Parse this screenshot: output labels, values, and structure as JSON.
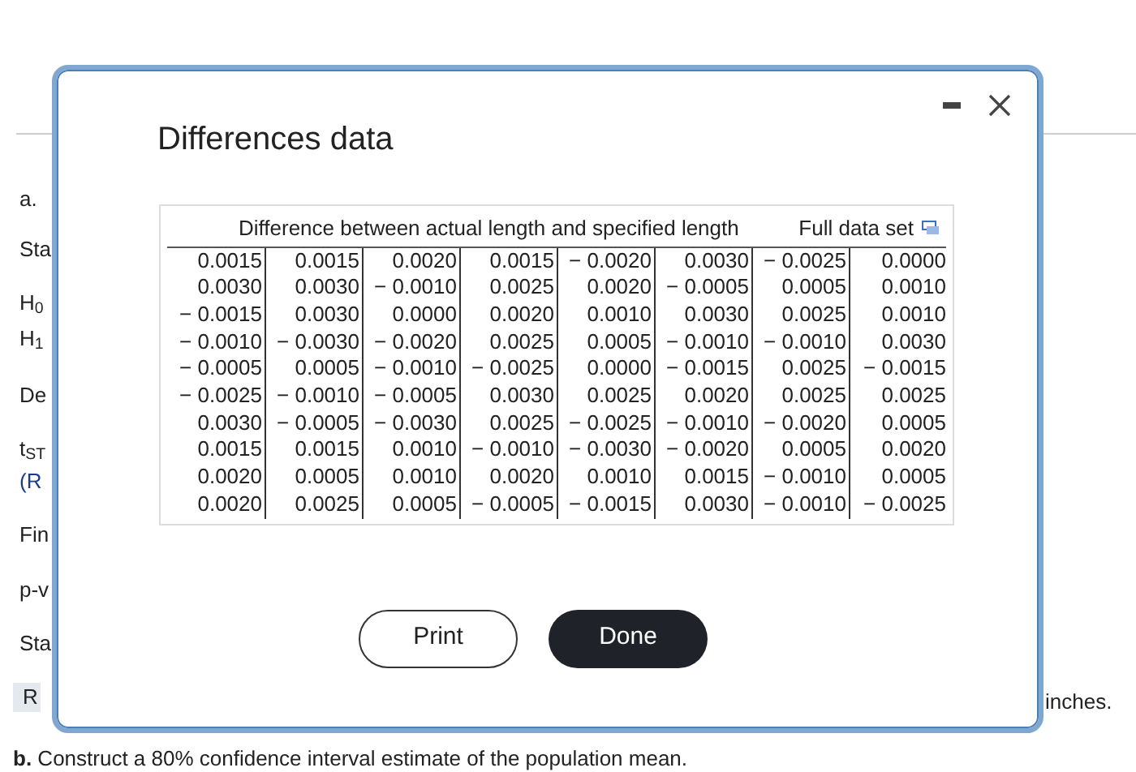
{
  "background": {
    "left_labels": [
      {
        "text": "a."
      },
      {
        "text": "Sta"
      },
      {
        "text": "H$_{0}$"
      },
      {
        "text": "H$_{1}$"
      },
      {
        "text": "De"
      },
      {
        "text": "t$_{ST}$"
      },
      {
        "text": "(R",
        "kind": "link"
      },
      {
        "text": "Fin"
      },
      {
        "text": "p-v"
      },
      {
        "text": "Sta"
      },
      {
        "text": "R",
        "kind": "highlight"
      }
    ],
    "right_text": "inches.",
    "question": "**b.** Construct a 80% confidence interval estimate of the population mean."
  },
  "dialog": {
    "title": "Differences data",
    "caption": "Difference between actual length and specified length",
    "full_data_link": "Full data set",
    "rows": [
      [
        "0.0015",
        "0.0015",
        "0.0020",
        "0.0015",
        "− 0.0020",
        "0.0030",
        "− 0.0025",
        "0.0000"
      ],
      [
        "0.0030",
        "0.0030",
        "− 0.0010",
        "0.0025",
        "0.0020",
        "− 0.0005",
        "0.0005",
        "0.0010"
      ],
      [
        "− 0.0015",
        "0.0030",
        "0.0000",
        "0.0020",
        "0.0010",
        "0.0030",
        "0.0025",
        "0.0010"
      ],
      [
        "− 0.0010",
        "− 0.0030",
        "− 0.0020",
        "0.0025",
        "0.0005",
        "− 0.0010",
        "− 0.0010",
        "0.0030"
      ],
      [
        "− 0.0005",
        "0.0005",
        "− 0.0010",
        "− 0.0025",
        "0.0000",
        "− 0.0015",
        "0.0025",
        "− 0.0015"
      ],
      [
        "− 0.0025",
        "− 0.0010",
        "− 0.0005",
        "0.0030",
        "0.0025",
        "0.0020",
        "0.0025",
        "0.0025"
      ],
      [
        "0.0030",
        "− 0.0005",
        "− 0.0030",
        "0.0025",
        "− 0.0025",
        "− 0.0010",
        "− 0.0020",
        "0.0005"
      ],
      [
        "0.0015",
        "0.0015",
        "0.0010",
        "− 0.0010",
        "− 0.0030",
        "− 0.0020",
        "0.0005",
        "0.0020"
      ],
      [
        "0.0020",
        "0.0005",
        "0.0010",
        "0.0020",
        "0.0010",
        "0.0015",
        "− 0.0010",
        "0.0005"
      ],
      [
        "0.0020",
        "0.0025",
        "0.0005",
        "− 0.0005",
        "− 0.0015",
        "0.0030",
        "− 0.0010",
        "− 0.0025"
      ]
    ],
    "buttons": [
      {
        "label": "Print",
        "kind": "secondary"
      },
      {
        "label": "Done",
        "kind": "primary"
      }
    ]
  }
}
